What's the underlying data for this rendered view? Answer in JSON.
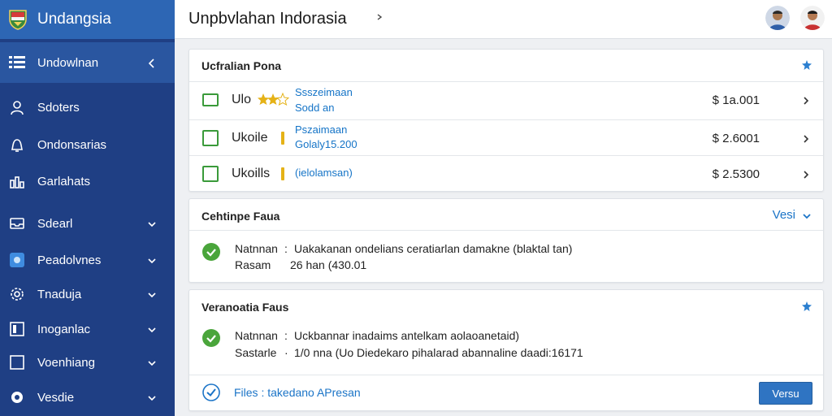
{
  "sidebar": {
    "brand": "Undangsia",
    "items": [
      {
        "label": "Undowlnan",
        "icon": "grid-icon"
      },
      {
        "label": "Sdoters",
        "icon": "users-icon"
      },
      {
        "label": "Ondonsarias",
        "icon": "bell-icon"
      },
      {
        "label": "Garlahats",
        "icon": "chart-icon"
      },
      {
        "label": "Sdearl",
        "icon": "inbox-icon"
      },
      {
        "label": "Peadolvnes",
        "icon": "app-icon"
      },
      {
        "label": "Tnaduja",
        "icon": "settings-icon"
      },
      {
        "label": "Inoganlac",
        "icon": "layout-icon"
      },
      {
        "label": "Voenhiang",
        "icon": "square-icon"
      },
      {
        "label": "Vesdie",
        "icon": "gear-icon"
      }
    ]
  },
  "header": {
    "title": "Unpbvlahan Indorasia",
    "avatars": [
      "avatar-user-1",
      "avatar-user-2"
    ]
  },
  "card1": {
    "title": "Ucfralian Pona",
    "rows": [
      {
        "name": "Ulo",
        "line1": "Ssszeimaan",
        "line2": "Sodd an",
        "amount": "$  1a.001"
      },
      {
        "name": "Ukoile",
        "line1": "Pszaimaan",
        "line2": "Golaly15.200",
        "amount": "$  2.6001"
      },
      {
        "name": "Ukoills",
        "line1": "(ielolamsan)",
        "line2": "",
        "amount": "$  2.5300"
      }
    ]
  },
  "card2": {
    "title": "Cehtinpe Faua",
    "action": "Vesi",
    "line1_label": "Natnnan",
    "line1_value": "Uakakanan ondelians ceratiarlan damakne (blaktal tan)",
    "line2_label": "Rasam",
    "line2_value": "26 han (430.01"
  },
  "card3": {
    "title": "Veranoatia Faus",
    "line1_label": "Natnnan",
    "line1_value": "Uckbannar inadaims antelkam aolaoanetaid)",
    "line2_label": "Sastarle",
    "line2_value": "1/0 nna (Uo Diedekaro pihalarad abannaline daadi:16171",
    "files_text": "Files : takedano APresan",
    "button": "Versu"
  },
  "colors": {
    "sidebar": "#1f3f84",
    "brand_bar": "#2d66b4",
    "accent": "#1b74c7",
    "success": "#4aa53b",
    "star": "#e5b217"
  }
}
